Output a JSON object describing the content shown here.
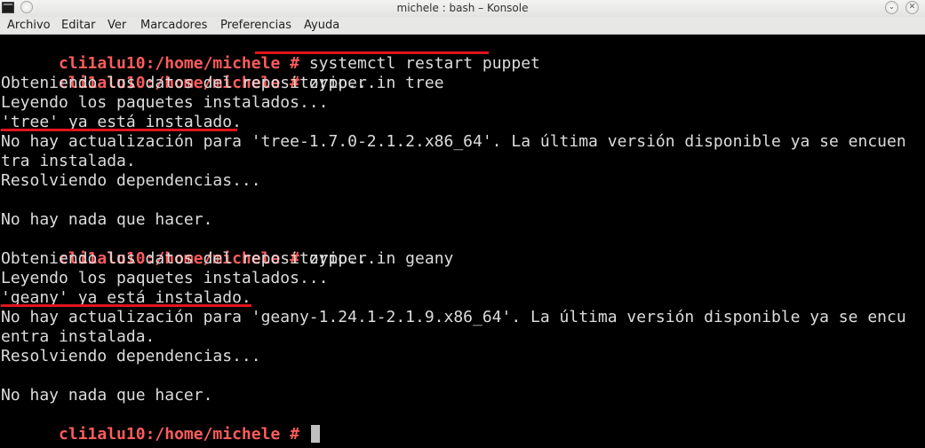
{
  "window": {
    "title": "michele : bash – Konsole"
  },
  "menubar": {
    "items": [
      "Archivo",
      "Editar",
      "Ver",
      "Marcadores",
      "Preferencias",
      "Ayuda"
    ]
  },
  "terminal": {
    "prompt": "cli1alu10:/home/michele #",
    "commands": [
      "systemctl restart puppet",
      "zypper in tree",
      "zypper in geany"
    ],
    "output": {
      "repo1": "Obteniendo los datos del repositorio...",
      "pkgs1": "Leyendo los paquetes instalados...",
      "installed1": "'tree' ya está instalado.",
      "noupdate1a": "No hay actualización para 'tree-1.7.0-2.1.2.x86_64'. La última versión disponible ya se encuen",
      "noupdate1b": "tra instalada.",
      "resolve1": "Resolviendo dependencias...",
      "nothing1": "No hay nada que hacer.",
      "repo2": "Obteniendo los datos del repositorio...",
      "pkgs2": "Leyendo los paquetes instalados...",
      "installed2": "'geany' ya está instalado.",
      "noupdate2a": "No hay actualización para 'geany-1.24.1-2.1.9.x86_64'. La última versión disponible ya se encu",
      "noupdate2b": "entra instalada.",
      "resolve2": "Resolviendo dependencias...",
      "nothing2": "No hay nada que hacer."
    }
  },
  "colors": {
    "prompt": "#ff5c5c",
    "text": "#dcdcdc",
    "background": "#000000",
    "underline": "#e2141c"
  }
}
